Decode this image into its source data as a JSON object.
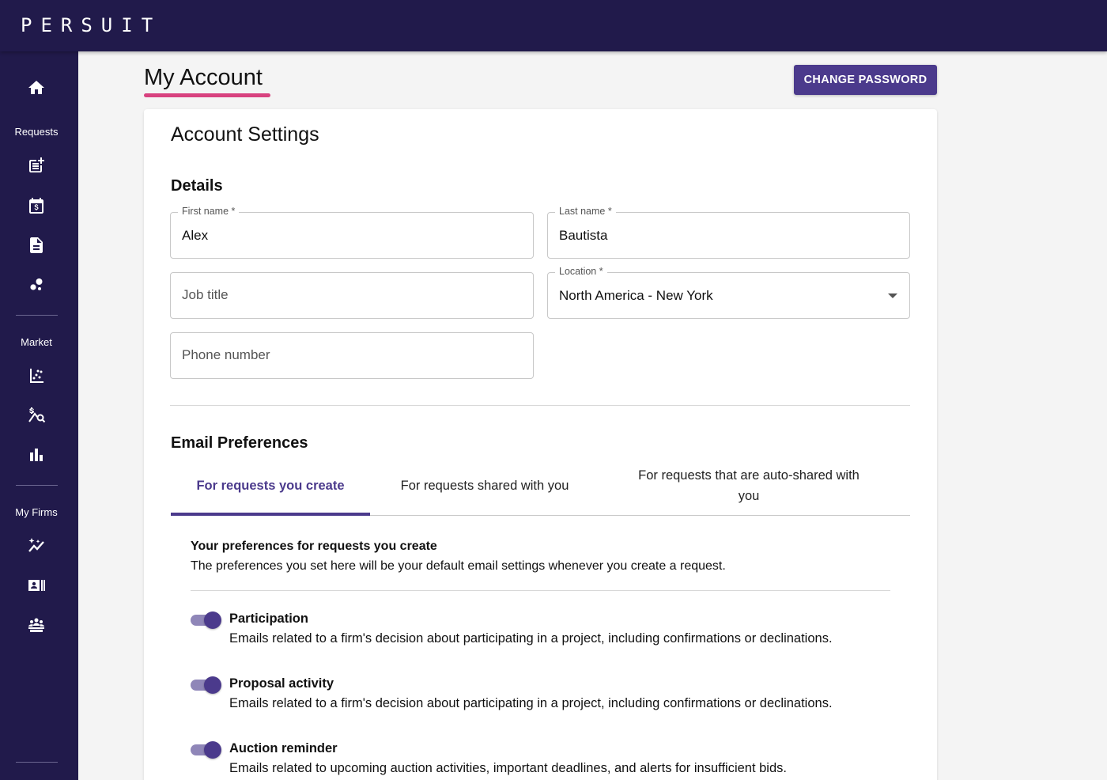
{
  "brand": {
    "logo": "PERSUIT"
  },
  "sidebar": {
    "home_icon": "home-icon",
    "sections": [
      {
        "label": "Requests",
        "icons": [
          "post-add-icon",
          "calendar-dollar-icon",
          "document-icon",
          "bubbles-icon"
        ]
      },
      {
        "label": "Market",
        "icons": [
          "scatter-chart-icon",
          "money-search-icon",
          "bar-chart-icon"
        ]
      },
      {
        "label": "My Firms",
        "icons": [
          "sparkle-trend-icon",
          "contact-card-icon",
          "group-icon"
        ]
      }
    ]
  },
  "header": {
    "title": "My Account",
    "change_password_label": "CHANGE PASSWORD"
  },
  "account_settings": {
    "title": "Account Settings",
    "details_title": "Details",
    "first_name": {
      "label": "First name *",
      "value": "Alex"
    },
    "last_name": {
      "label": "Last name *",
      "value": "Bautista"
    },
    "job_title": {
      "placeholder": "Job title"
    },
    "location": {
      "label": "Location *",
      "value": "North America - New York"
    },
    "phone_number": {
      "placeholder": "Phone number"
    }
  },
  "email_preferences": {
    "title": "Email Preferences",
    "tabs": [
      {
        "label": "For requests you create",
        "active": true
      },
      {
        "label": "For requests shared with you",
        "active": false
      },
      {
        "label_line1": "For requests that are auto-shared with",
        "label_line2": "you",
        "active": false
      }
    ],
    "heading": "Your preferences for requests you create",
    "description": "The preferences you set here will be your default email settings whenever you create a request.",
    "items": [
      {
        "title": "Participation",
        "description": "Emails related to a firm's decision about participating in a project, including confirmations or declinations.",
        "enabled": true
      },
      {
        "title": "Proposal activity",
        "description": "Emails related to a firm's decision about participating in a project, including confirmations or declinations.",
        "enabled": true
      },
      {
        "title": "Auction reminder",
        "description": "Emails related to upcoming auction activities, important deadlines, and alerts for insufficient bids.",
        "enabled": true
      }
    ]
  },
  "colors": {
    "nav_bg": "#211a4b",
    "primary": "#4b3a8c",
    "accent": "#d8427f",
    "toggle_track": "#8f86b8"
  }
}
